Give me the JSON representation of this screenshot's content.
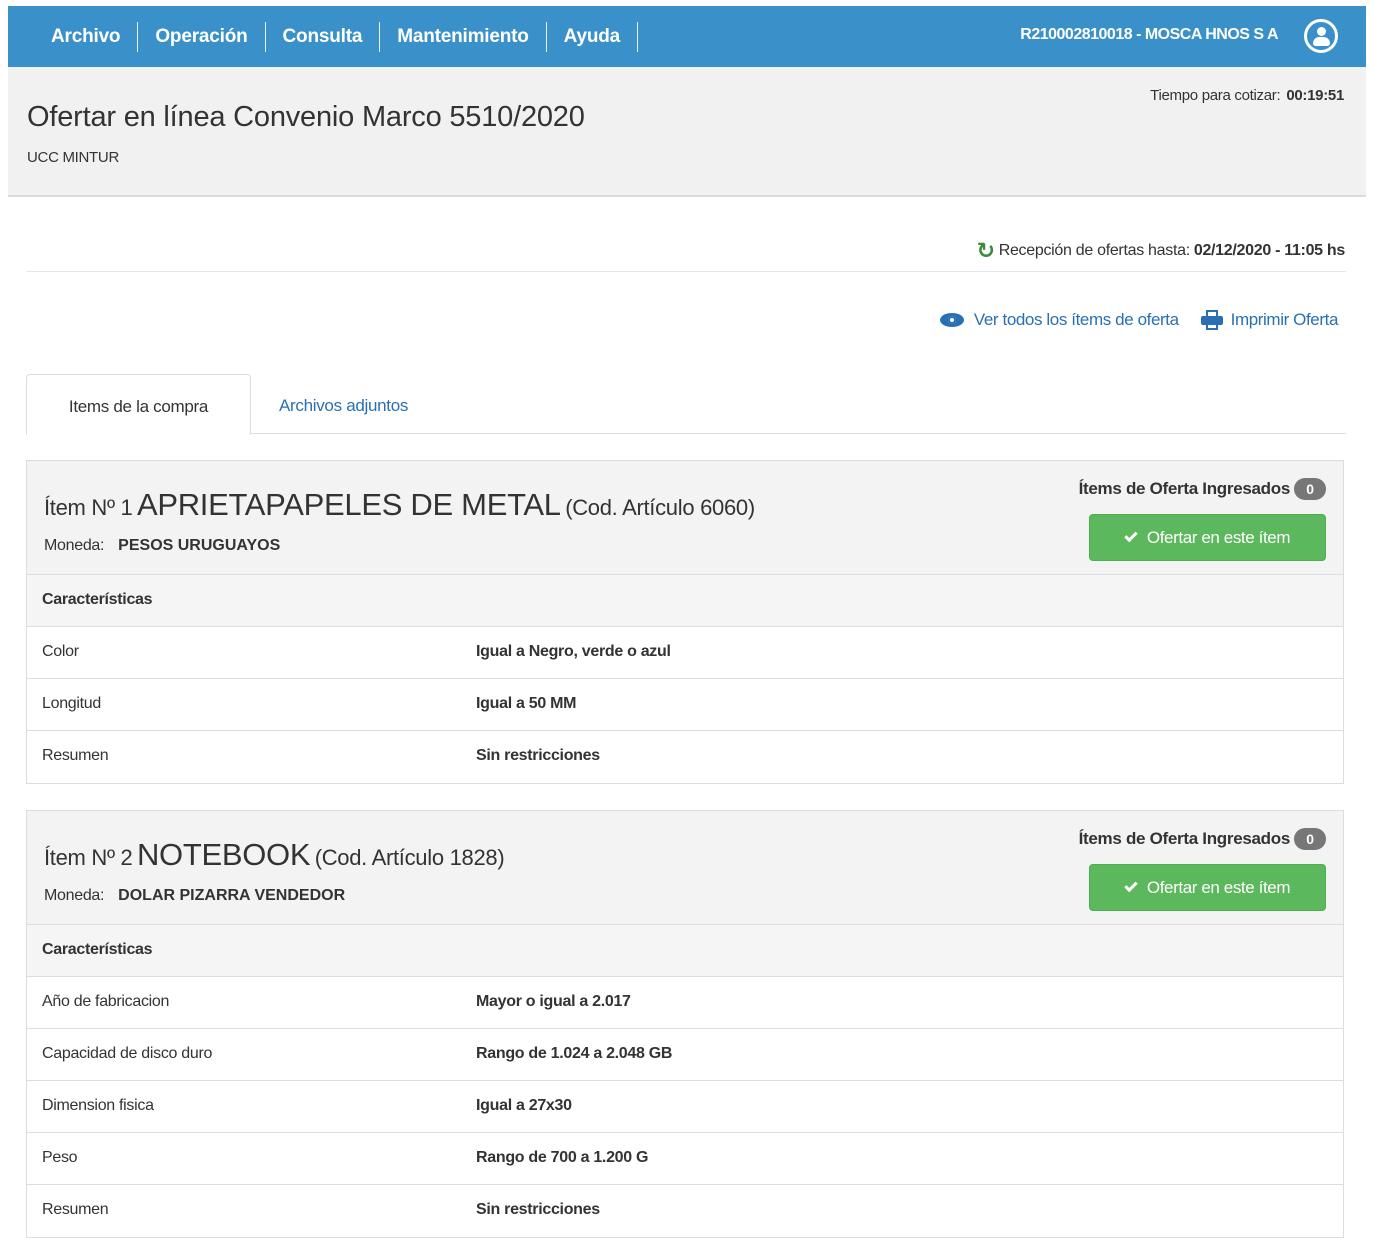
{
  "nav": {
    "items": [
      "Archivo",
      "Operación",
      "Consulta",
      "Mantenimiento",
      "Ayuda"
    ],
    "user": "R210002810018 - MOSCA HNOS S A",
    "user_icon": "user-circle-icon"
  },
  "header": {
    "time_label": "Tiempo para cotizar:",
    "time_value": "00:19:51",
    "title": "Ofertar en línea Convenio Marco 5510/2020",
    "subtitle": "UCC MINTUR"
  },
  "reception": {
    "label": "Recepción de ofertas hasta:",
    "value": "02/12/2020 - 11:05 hs"
  },
  "links": {
    "view_all": "Ver todos los ítems de oferta",
    "print": "Imprimir Oferta"
  },
  "tabs": [
    "Items de la compra",
    "Archivos adjuntos"
  ],
  "items": [
    {
      "prefix": "Ítem Nº 1",
      "name": "APRIETAPAPELES DE METAL",
      "code": "(Cod. Artículo 6060)",
      "moneda_label": "Moneda:",
      "moneda": "PESOS URUGUAYOS",
      "ingresados_label": "Ítems de Oferta Ingresados",
      "ingresados_count": "0",
      "button": "Ofertar en este ítem",
      "char_header": "Características",
      "chars": [
        {
          "k": "Color",
          "v": "Igual a Negro, verde o azul"
        },
        {
          "k": "Longitud",
          "v": "Igual a 50 MM"
        },
        {
          "k": "Resumen",
          "v": "Sin restricciones"
        }
      ]
    },
    {
      "prefix": "Ítem Nº 2",
      "name": "NOTEBOOK",
      "code": "(Cod. Artículo 1828)",
      "moneda_label": "Moneda:",
      "moneda": "DOLAR PIZARRA VENDEDOR",
      "ingresados_label": "Ítems de Oferta Ingresados",
      "ingresados_count": "0",
      "button": "Ofertar en este ítem",
      "char_header": "Características",
      "chars": [
        {
          "k": "Año de fabricacion",
          "v": "Mayor o igual a 2.017"
        },
        {
          "k": "Capacidad de disco duro",
          "v": "Rango de 1.024 a 2.048 GB"
        },
        {
          "k": "Dimension fisica",
          "v": "Igual a 27x30"
        },
        {
          "k": "Peso",
          "v": "Rango de 700 a 1.200 G"
        },
        {
          "k": "Resumen",
          "v": "Sin restricciones"
        }
      ]
    }
  ]
}
